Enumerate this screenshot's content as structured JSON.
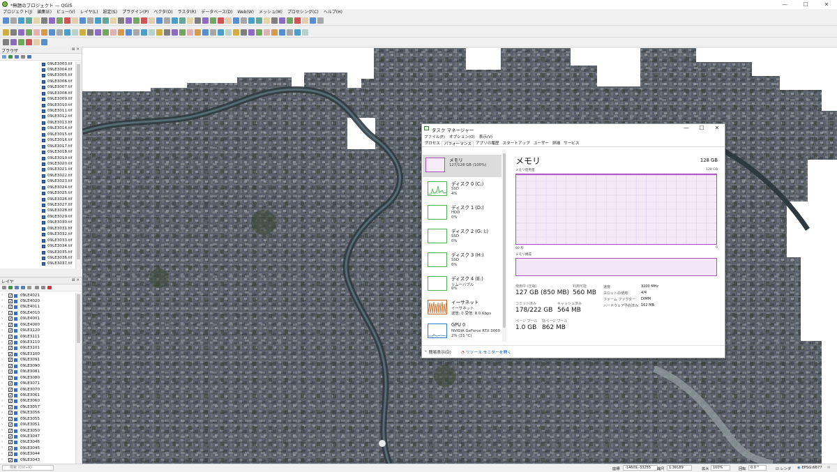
{
  "window": {
    "title": "*無題のプロジェクト — QGIS"
  },
  "menu": [
    "プロジェクト(J)",
    "編集(E)",
    "ビュー(V)",
    "レイヤ(L)",
    "設定(S)",
    "プラグイン(P)",
    "ベクタ(O)",
    "ラスタ(R)",
    "データベース(D)",
    "Web(W)",
    "メッシュ(M)",
    "プロセシング(C)",
    "ヘルプ(H)"
  ],
  "browser": {
    "title": "ブラウザ",
    "close_label": "⊠ ✕",
    "items": [
      "09LE3003.tif",
      "09LE3004.tif",
      "09LE3005.tif",
      "09LE3006.tif",
      "09LE3007.tif",
      "09LE3008.tif",
      "09LE3009.tif",
      "09LE3010.tif",
      "09LE3011.tif",
      "09LE3012.tif",
      "09LE3013.tif",
      "09LE3014.tif",
      "09LE3015.tif",
      "09LE3016.tif",
      "09LE3017.tif",
      "09LE3018.tif",
      "09LE3019.tif",
      "09LE3020.tif",
      "09LE3021.tif",
      "09LE3022.tif",
      "09LE3023.tif",
      "09LE3024.tif",
      "09LE3025.tif",
      "09LE3026.tif",
      "09LE3027.tif",
      "09LE3028.tif",
      "09LE3029.tif",
      "09LE3030.tif",
      "09LE3031.tif",
      "09LE3032.tif",
      "09LE3033.tif",
      "09LE3034.tif",
      "09LE3035.tif",
      "09LE3036.tif",
      "09LE3037.tif"
    ]
  },
  "layers_panel": {
    "title": "レイヤ",
    "close_label": "⊠ ✕",
    "items": [
      "09LE4021",
      "09LE4020",
      "09LE4011",
      "09LE4010",
      "09LE4001",
      "09LE4000",
      "09LE3120",
      "09LE3111",
      "09LE3110",
      "09LE3101",
      "09LE3100",
      "09LE3091",
      "09LE3090",
      "09LE3081",
      "09LE3080",
      "09LE3071",
      "09LE3070",
      "09LE3061",
      "09LE3060",
      "09LE3057",
      "09LE3056",
      "09LE3055",
      "09LE3051",
      "09LE3050",
      "09LE3047",
      "09LE3046",
      "09LE3045",
      "09LE3044",
      "09LE3043"
    ]
  },
  "statusbar": {
    "locator_placeholder": "検索 (Ctrl+K)",
    "coord_label": "座標",
    "coord_value": "-14609,-33255",
    "scale_label": "縮尺",
    "scale_value": "1:39189",
    "magnifier_label": "拡大",
    "magnifier_value": "100%",
    "rotation_label": "回転",
    "rotation_value": "0.0 °",
    "render_label": "レンダ",
    "crs_label": "EPSG:6677"
  },
  "taskmanager": {
    "title": "タスク マネージャー",
    "menu": [
      "ファイル(F)",
      "オプション(O)",
      "表示(V)"
    ],
    "tabs": [
      "プロセス",
      "パフォーマンス",
      "アプリの履歴",
      "スタートアップ",
      "ユーザー",
      "詳細",
      "サービス"
    ],
    "active_tab": 1,
    "sidebar": [
      {
        "name": "メモリ",
        "line2": "127/128 GB (100%)",
        "line3": ""
      },
      {
        "name": "ディスク 0 (C:)",
        "line2": "SSD",
        "line3": "4%"
      },
      {
        "name": "ディスク 1 (D:)",
        "line2": "HDD",
        "line3": "0%"
      },
      {
        "name": "ディスク 2 (G: I:)",
        "line2": "SSD",
        "line3": "0%"
      },
      {
        "name": "ディスク 3 (H:)",
        "line2": "SSD",
        "line3": "0%"
      },
      {
        "name": "ディスク 4 (E:)",
        "line2": "リムーバブル",
        "line3": "0%"
      },
      {
        "name": "イーサネット",
        "line2": "イーサネット",
        "line3": "送信: 0 受信: 8.0 Kbps"
      },
      {
        "name": "GPU 0",
        "line2": "NVIDIA GeForce RTX 3060",
        "line3": "2% (33 °C)"
      }
    ],
    "main": {
      "heading": "メモリ",
      "capacity": "128 GB",
      "usage_label": "メモリ使用量",
      "usage_max": "128 GB",
      "time_left": "60 秒",
      "time_right": "0",
      "composition_label": "メモリ構成",
      "in_use_label": "使用中 (圧縮)",
      "in_use_value": "127 GB (850 MB)",
      "available_label": "利用可能",
      "available_value": "560 MB",
      "committed_label": "コミット済み",
      "committed_value": "178/222 GB",
      "cached_label": "キャッシュ済み",
      "cached_value": "564 MB",
      "paged_label": "ページ プール",
      "paged_value": "1.0 GB",
      "nonpaged_label": "非ページ プール",
      "nonpaged_value": "862 MB",
      "speed_label": "速度:",
      "speed_value": "3200 MHz",
      "slots_label": "スロットの使用:",
      "slots_value": "4/4",
      "form_label": "フォーム ファクター:",
      "form_value": "DIMM",
      "reserved_label": "ハードウェア予約済み:",
      "reserved_value": "162 MB"
    },
    "footer": {
      "less_details": "簡易表示(D)",
      "resource_monitor": "リソース モニターを開く"
    }
  },
  "colors": {
    "accent_memory": "#a84fbf",
    "accent_disk": "#4caf50",
    "accent_ethernet": "#c7651b",
    "accent_gpu": "#2e7cc7"
  }
}
